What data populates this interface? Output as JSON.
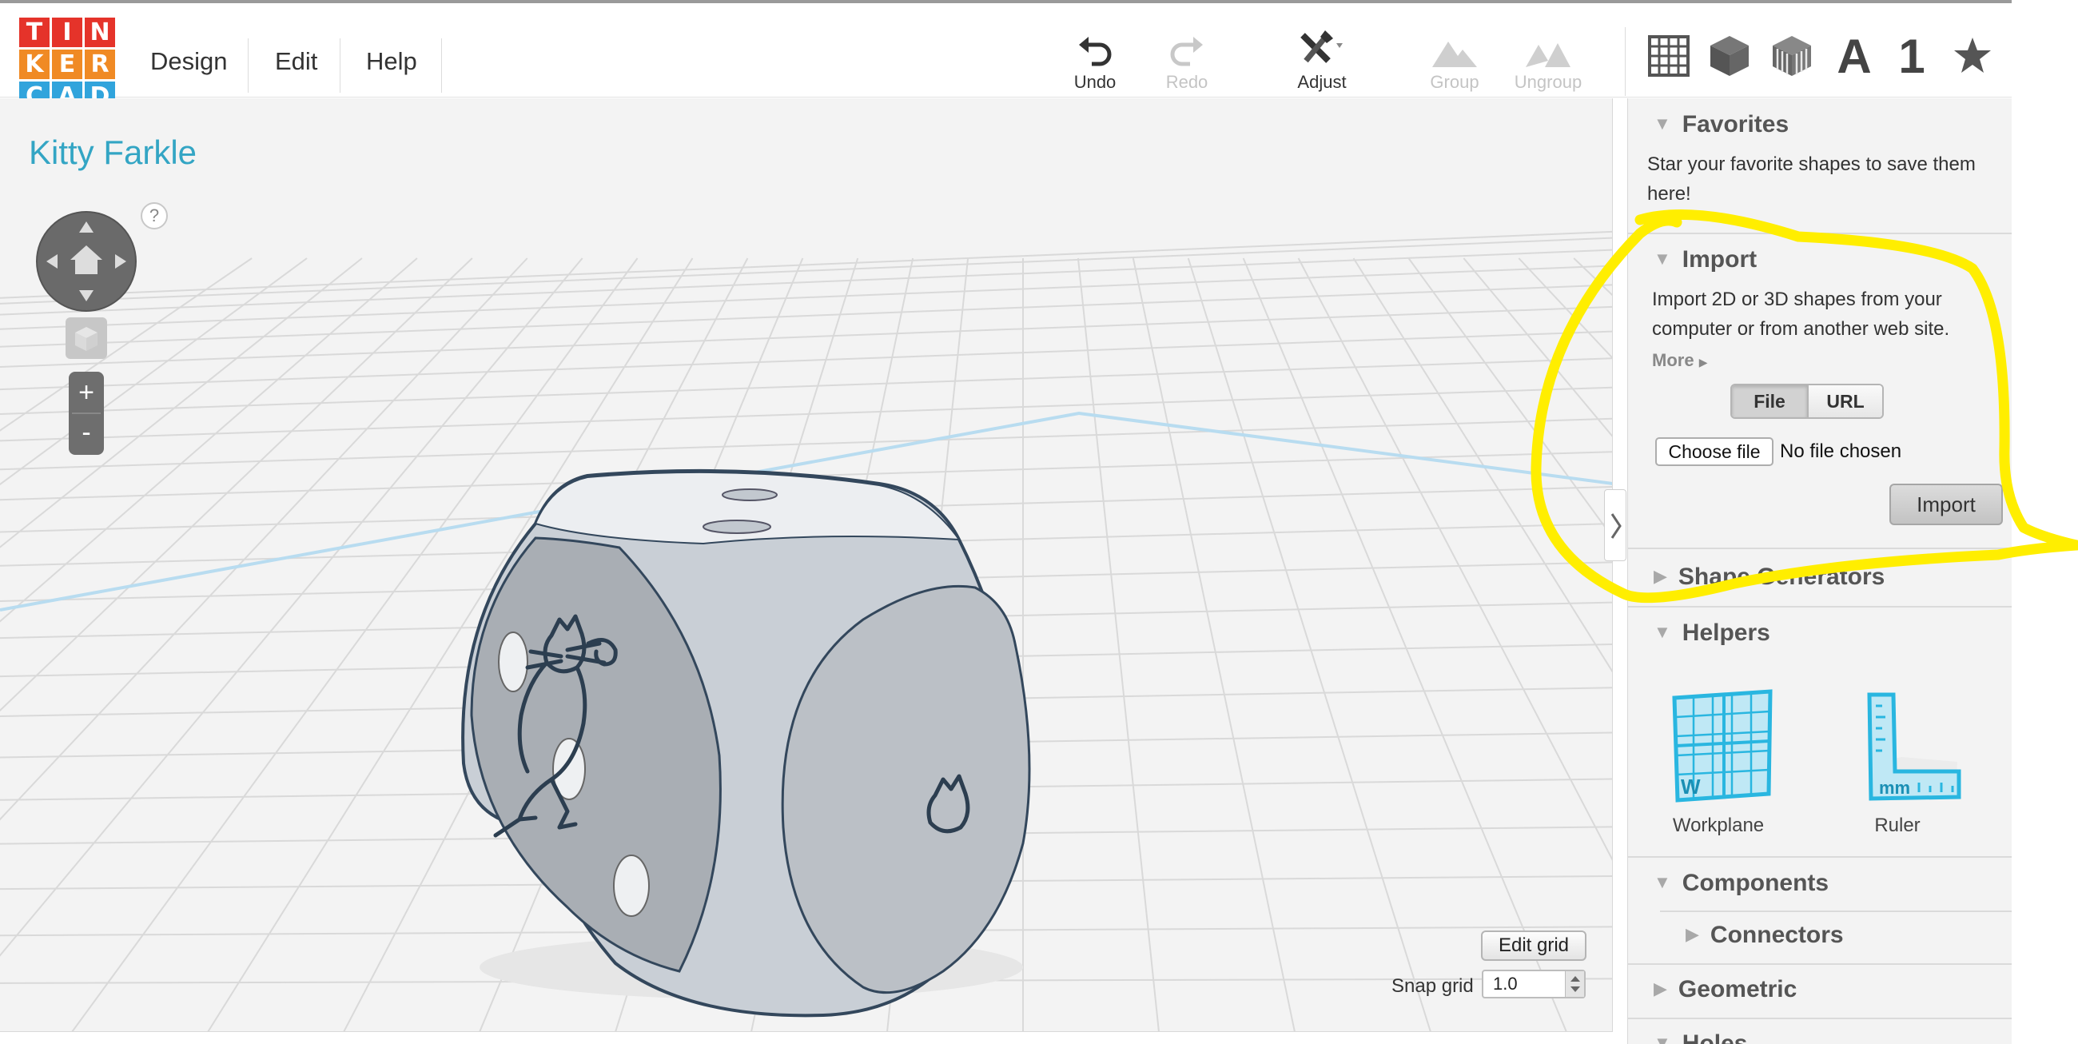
{
  "logo": {
    "letters": [
      "T",
      "I",
      "N",
      "K",
      "E",
      "R",
      "C",
      "A",
      "D"
    ],
    "colors": [
      "#e5332a",
      "#e5332a",
      "#e5332a",
      "#f08a24",
      "#f08a24",
      "#f08a24",
      "#31a4dc",
      "#31a4dc",
      "#31a4dc"
    ]
  },
  "menu": {
    "design": "Design",
    "edit": "Edit",
    "help": "Help"
  },
  "toolbar": {
    "undo": "Undo",
    "redo": "Redo",
    "adjust": "Adjust",
    "group": "Group",
    "ungroup": "Ungroup"
  },
  "shape_tabs": {
    "text_tab": "A",
    "number_tab": "1"
  },
  "design_title": "Kitty Farkle",
  "viewport": {
    "help": "?",
    "zoom_in": "+",
    "zoom_out": "-",
    "edit_grid": "Edit grid",
    "snap_grid_label": "Snap grid",
    "snap_grid_value": "1.0"
  },
  "panel": {
    "favorites": {
      "title": "Favorites",
      "text": "Star your favorite shapes to save them here!"
    },
    "import": {
      "title": "Import",
      "text": "Import 2D or 3D shapes from your computer or from another web site.",
      "more": "More",
      "tab_file": "File",
      "tab_url": "URL",
      "choose_file": "Choose file",
      "no_file": "No file chosen",
      "import_button": "Import"
    },
    "shape_generators": {
      "title": "Shape Generators"
    },
    "helpers": {
      "title": "Helpers",
      "items": [
        {
          "label": "Workplane",
          "badge": "W"
        },
        {
          "label": "Ruler",
          "badge": "mm"
        }
      ]
    },
    "components": {
      "title": "Components",
      "connectors": "Connectors"
    },
    "geometric": {
      "title": "Geometric"
    },
    "holes": {
      "title": "Holes"
    }
  },
  "colors": {
    "accent": "#33a5c4",
    "annotation": "#ffee00",
    "helper_blue": "#29b6e0"
  }
}
